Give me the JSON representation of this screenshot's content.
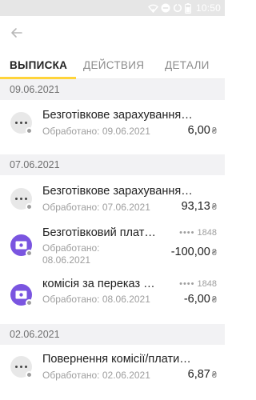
{
  "status_bar": {
    "time": "10:50"
  },
  "icons": {
    "back": "arrow-left-icon",
    "status": [
      "wifi-icon",
      "do-not-disturb-icon",
      "sync-icon",
      "battery-icon"
    ],
    "operation": "more-dots-icon",
    "card_op": "banknote-icon"
  },
  "tabs": [
    {
      "label": "ВЫПИСКА",
      "active": true
    },
    {
      "label": "ДЕЙСТВИЯ",
      "active": false
    },
    {
      "label": "ДЕТАЛИ",
      "active": false
    }
  ],
  "colors": {
    "accent": "#ffd43b",
    "purple_icon": "#7a55e0",
    "date_header_bg": "#f2f2f4"
  },
  "groups": [
    {
      "date": "09.06.2021",
      "transactions": [
        {
          "title": "Безготівкове зарахування…",
          "processed": "Обработано: 09.06.2021",
          "amount": "6,00",
          "currency": "₴"
        }
      ]
    },
    {
      "date": "07.06.2021",
      "transactions": [
        {
          "title": "Безготівкове зарахування…",
          "processed": "Обработано: 07.06.2021",
          "amount": "93,13",
          "currency": "₴"
        },
        {
          "title": "Безготівковий плат…",
          "card_mask": "••••",
          "card_last4": "1848",
          "processed_line1": "Обработано:",
          "processed_line2": "08.06.2021",
          "amount": "-100,00",
          "currency": "₴"
        },
        {
          "title": "комісія за переказ …",
          "card_mask": "••••",
          "card_last4": "1848",
          "processed": "Обработано: 08.06.2021",
          "amount": "-6,00",
          "currency": "₴"
        }
      ]
    },
    {
      "date": "02.06.2021",
      "transactions": [
        {
          "title": "Повернення комісії/плати…",
          "processed": "Обработано: 02.06.2021",
          "amount": "6,87",
          "currency": "₴"
        }
      ]
    }
  ]
}
